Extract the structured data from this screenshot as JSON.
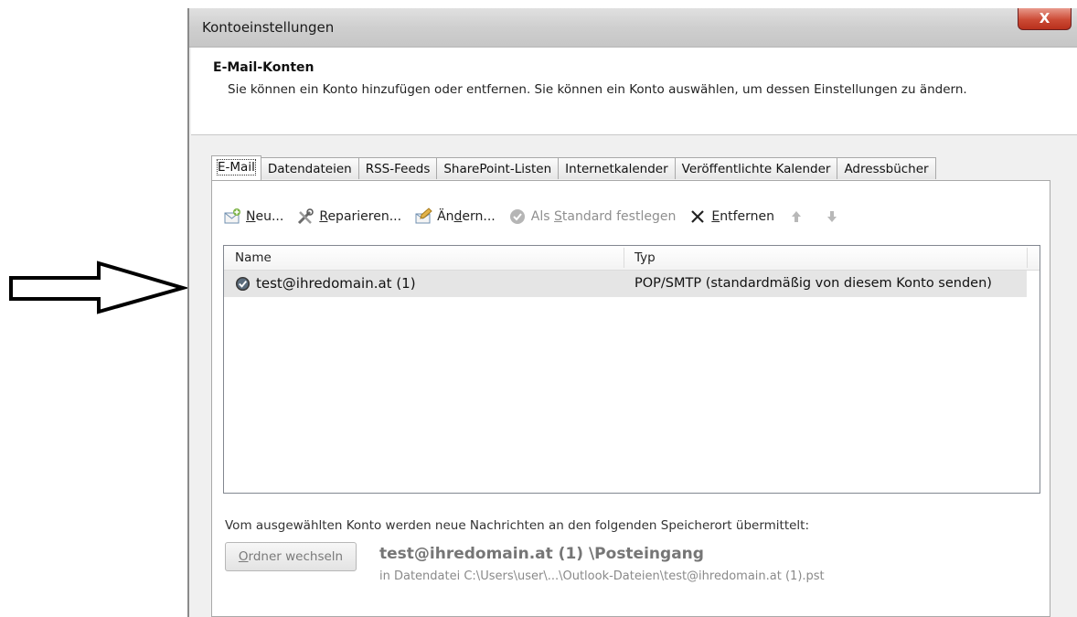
{
  "window": {
    "title": "Kontoeinstellungen",
    "close_label": "X"
  },
  "header": {
    "heading": "E-Mail-Konten",
    "description": "Sie können ein Konto hinzufügen oder entfernen. Sie können ein Konto auswählen, um dessen Einstellungen zu ändern."
  },
  "tabs": [
    {
      "label": "E-Mail",
      "active": true
    },
    {
      "label": "Datendateien"
    },
    {
      "label": "RSS-Feeds"
    },
    {
      "label": "SharePoint-Listen"
    },
    {
      "label": "Internetkalender"
    },
    {
      "label": "Veröffentlichte Kalender"
    },
    {
      "label": "Adressbücher"
    }
  ],
  "toolbar": {
    "new_label": "Neu...",
    "repair_label": "Reparieren...",
    "change_label": "Ändern...",
    "default_label": "Als Standard festlegen",
    "remove_label": "Entfernen"
  },
  "list": {
    "columns": [
      "Name",
      "Typ"
    ],
    "rows": [
      {
        "name": "test@ihredomain.at (1)",
        "type": "POP/SMTP (standardmäßig von diesem Konto senden)"
      }
    ]
  },
  "footer": {
    "delivery_text": "Vom ausgewählten Konto werden neue Nachrichten an den folgenden Speicherort übermittelt:",
    "change_folder_label": "Ordner wechseln",
    "destination": "test@ihredomain.at (1) \\Posteingang",
    "datafile": "in Datendatei C:\\Users\\user\\...\\Outlook-Dateien\\test@ihredomain.at (1).pst"
  },
  "colors": {
    "accent_close": "#c8432d",
    "selected_row": "#e5e5e5"
  }
}
